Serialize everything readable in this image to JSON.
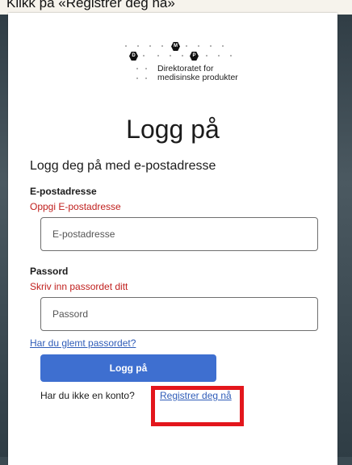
{
  "caption": "Klikk på «Registrer deg nå»",
  "logo": {
    "badges": [
      "D",
      "M",
      "P"
    ],
    "line1": "Direktoratet for",
    "line2": "medisinske produkter"
  },
  "title": "Logg på",
  "subtitle": "Logg deg på med e-postadresse",
  "email": {
    "label": "E-postadresse",
    "error": "Oppgi E-postadresse",
    "placeholder": "E-postadresse",
    "value": ""
  },
  "password": {
    "label": "Passord",
    "error": "Skriv inn passordet ditt",
    "placeholder": "Passord",
    "value": ""
  },
  "forgot_link": "Har du glemt passordet?",
  "login_button": "Logg på",
  "no_account_text": "Har du ikke en konto?",
  "register_link": "Registrer deg nå",
  "colors": {
    "primary": "#3e6fd0",
    "link": "#2f5cb8",
    "error": "#c0201e",
    "highlight": "#e3161c"
  }
}
